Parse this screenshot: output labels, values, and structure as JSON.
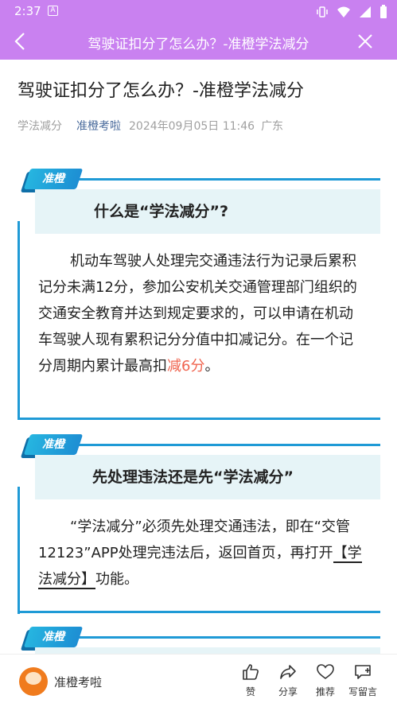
{
  "status_bar": {
    "time": "2:37",
    "notif_glyph": "A"
  },
  "nav": {
    "title": "驾驶证扣分了怎么办？-准橙学法减分"
  },
  "article": {
    "title": "驾驶证扣分了怎么办？-准橙学法减分",
    "meta": {
      "category": "学法减分",
      "author": "准橙考啦",
      "datetime": "2024年09月05日 11:46",
      "location": "广东"
    }
  },
  "sections": [
    {
      "tag": "准橙",
      "heading": "什么是“学法减分”?",
      "body_before": "机动车驾驶人处理完交通违法行为记录后累积记分未满12分，参加公安机关交通管理部门组织的交通安全教育并达到规定要求的，可以申请在机动车驾驶人现有累积记分分值中扣减记分。在一个记分周期内累计最高扣",
      "body_highlight": "减6分",
      "body_after": "。"
    },
    {
      "tag": "准橙",
      "heading": "先处理违法还是先“学法减分”",
      "body_before": "“学法减分”必须先处理交通违法，即在“交管12123”APP处理完违法后，返回首页，再打开",
      "body_highlight": "【学法减分】",
      "body_after": "功能。"
    },
    {
      "tag": "准橙"
    }
  ],
  "bottom": {
    "name": "准橙考啦",
    "actions": {
      "like": "赞",
      "share": "分享",
      "recommend": "推荐",
      "comment": "写留言"
    }
  },
  "colors": {
    "nav_bg": "#c981f0",
    "accent_blue": "#1f9ad6",
    "highlight_red": "#f0644f",
    "section_bg": "#e6f4f7"
  }
}
